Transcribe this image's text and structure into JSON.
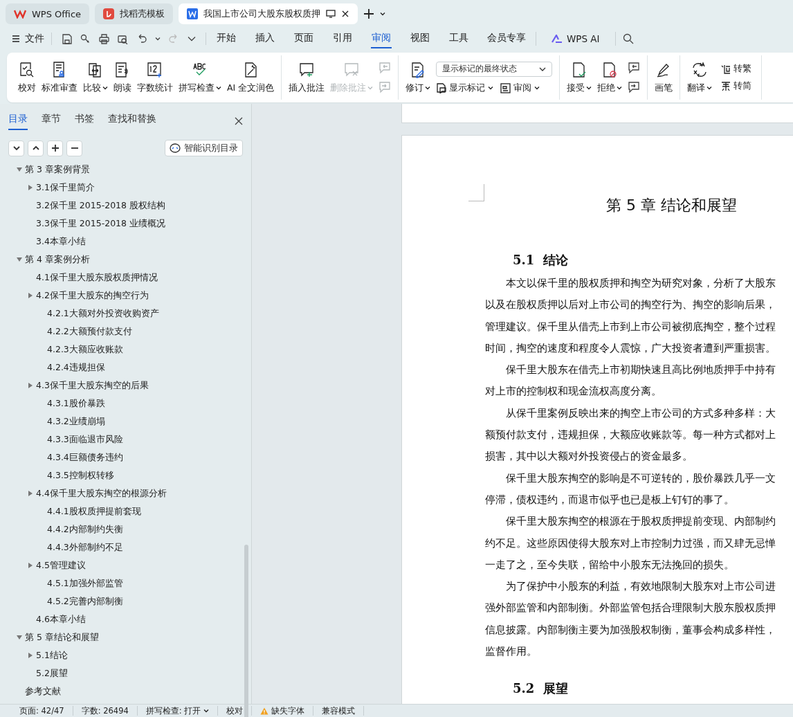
{
  "app_tabs": [
    {
      "label": "WPS Office",
      "selected": false
    },
    {
      "label": "找稻壳模板",
      "selected": false
    },
    {
      "label": "我国上市公司大股东股权质押",
      "selected": true
    }
  ],
  "menu": {
    "file": "文件",
    "tabs": [
      {
        "label": "开始",
        "selected": false
      },
      {
        "label": "插入",
        "selected": false
      },
      {
        "label": "页面",
        "selected": false
      },
      {
        "label": "引用",
        "selected": false
      },
      {
        "label": "审阅",
        "selected": true
      },
      {
        "label": "视图",
        "selected": false
      },
      {
        "label": "工具",
        "selected": false
      },
      {
        "label": "会员专享",
        "selected": false
      }
    ],
    "ai": "WPS AI"
  },
  "ribbon": [
    [
      {
        "kind": "large",
        "label": "校对"
      },
      {
        "kind": "large",
        "label": "标准审查"
      },
      {
        "kind": "large",
        "label": "比较",
        "dropdown": true
      },
      {
        "kind": "large",
        "label": "朗读"
      },
      {
        "kind": "large",
        "label": "字数统计"
      },
      {
        "kind": "large",
        "label": "拼写检查",
        "dropdown": true
      },
      {
        "kind": "large",
        "label": "AI 全文润色"
      }
    ],
    [
      {
        "kind": "large",
        "label": "插入批注"
      },
      {
        "kind": "large",
        "label": "删除批注",
        "dropdown": true,
        "disabled": true
      },
      {
        "kind": "pair",
        "disabled": true
      }
    ],
    [
      {
        "kind": "large",
        "label": "修订",
        "dropdown": true
      },
      {
        "kind": "stack",
        "select": "显示标记的最终状态",
        "items": [
          {
            "label": "显示标记",
            "dropdown": true
          },
          {
            "label": "审阅",
            "dropdown": true
          }
        ]
      }
    ],
    [
      {
        "kind": "large",
        "label": "接受",
        "dropdown": true
      },
      {
        "kind": "large",
        "label": "拒绝",
        "dropdown": true
      },
      {
        "kind": "pair",
        "disabled": false
      }
    ],
    [
      {
        "kind": "large",
        "label": "画笔"
      }
    ],
    [
      {
        "kind": "large",
        "label": "翻译",
        "dropdown": true
      },
      {
        "kind": "stack",
        "items": [
          {
            "label": "转繁",
            "dropdown": false
          },
          {
            "label": "转简",
            "dropdown": false
          }
        ]
      }
    ]
  ],
  "sidebar": {
    "tabs": [
      {
        "label": "目录",
        "selected": true
      },
      {
        "label": "章节",
        "selected": false
      },
      {
        "label": "书签",
        "selected": false
      },
      {
        "label": "查找和替换",
        "selected": false
      }
    ],
    "smart_button": "智能识别目录",
    "tree": [
      {
        "label": "第 3 章案例背景",
        "expanded": true,
        "children": [
          {
            "label": "3.1保千里简介",
            "expanded": false
          },
          {
            "label": "3.2保千里 2015-2018 股权结构"
          },
          {
            "label": "3.3保千里 2015-2018 业绩概况"
          },
          {
            "label": "3.4本章小结"
          }
        ]
      },
      {
        "label": "第 4 章案例分析",
        "expanded": true,
        "children": [
          {
            "label": "4.1保千里大股东股权质押情况"
          },
          {
            "label": "4.2保千里大股东的掏空行为",
            "expanded": false,
            "children": [
              {
                "label": "4.2.1大额对外投资收购资产"
              },
              {
                "label": "4.2.2大额预付款支付"
              },
              {
                "label": "4.2.3大额应收账款"
              },
              {
                "label": "4.2.4违规担保"
              }
            ]
          },
          {
            "label": "4.3保千里大股东掏空的后果",
            "expanded": false,
            "children": [
              {
                "label": "4.3.1股价暴跌"
              },
              {
                "label": "4.3.2业绩崩塌"
              },
              {
                "label": "4.3.3面临退市风险"
              },
              {
                "label": "4.3.4巨额债务违约"
              },
              {
                "label": "4.3.5控制权转移"
              }
            ]
          },
          {
            "label": "4.4保千里大股东掏空的根源分析",
            "expanded": false,
            "children": [
              {
                "label": "4.4.1股权质押提前套现"
              },
              {
                "label": "4.4.2内部制约失衡"
              },
              {
                "label": "4.4.3外部制约不足"
              }
            ]
          },
          {
            "label": "4.5管理建议",
            "expanded": false,
            "children": [
              {
                "label": "4.5.1加强外部监管"
              },
              {
                "label": "4.5.2完善内部制衡"
              }
            ]
          },
          {
            "label": "4.6本章小结"
          }
        ]
      },
      {
        "label": "第 5 章结论和展望",
        "expanded": true,
        "children": [
          {
            "label": "5.1结论",
            "expanded": false
          },
          {
            "label": "5.2展望"
          }
        ]
      },
      {
        "label": "参考文献"
      }
    ]
  },
  "document": {
    "title": "第 5 章  结论和展望",
    "heading": "5.1  结论",
    "paragraphs": [
      {
        "lines": [
          "本文以保千里的股权质押和掏空为研究对象，分析了大股东",
          "以及在股权质押以后对上市公司的掏空行为、掏空的影响后果，",
          "管理建议。保千里从借壳上市到上市公司被彻底掏空，整个过程",
          "时间，掏空的速度和程度令人震惊，广大投资者遭到严重损害。"
        ]
      },
      {
        "lines": [
          "保千里大股东在借壳上市初期快速且高比例地质押手中持有",
          "对上市的控制权和现金流权高度分离。"
        ]
      },
      {
        "lines": [
          "从保千里案例反映出来的掏空上市公司的方式多种多样：大",
          "额预付款支付，违规担保，大额应收账款等。每一种方式都对上",
          "损害，其中以大额对外投资侵占的资金最多。"
        ]
      },
      {
        "lines": [
          "保千里大股东掏空的影响是不可逆转的，股价暴跌几乎一文",
          "停滞，债权违约，而退市似乎也已是板上钉钉的事了。"
        ]
      },
      {
        "lines": [
          "保千里大股东掏空的根源在于股权质押提前变现、内部制约",
          "约不足。这些原因使得大股东对上市控制力过强，而又肆无忌惮",
          "一走了之，至今失联，留给中小股东无法挽回的损失。"
        ]
      },
      {
        "lines": [
          "为了保护中小股东的利益，有效地限制大股东对上市公司进",
          "强外部监管和内部制衡。外部监管包括合理限制大股东股权质押",
          "信息披露。内部制衡主要为加强股权制衡，董事会构成多样性，",
          "监督作用。"
        ]
      }
    ],
    "next_heading": "5.2  展望"
  },
  "status_bar": {
    "page": "页面: 42/47",
    "words": "字数: 26494",
    "spell": "拼写检查: 打开",
    "proof": "校对",
    "warning": "缺失字体",
    "mode": "兼容模式"
  }
}
